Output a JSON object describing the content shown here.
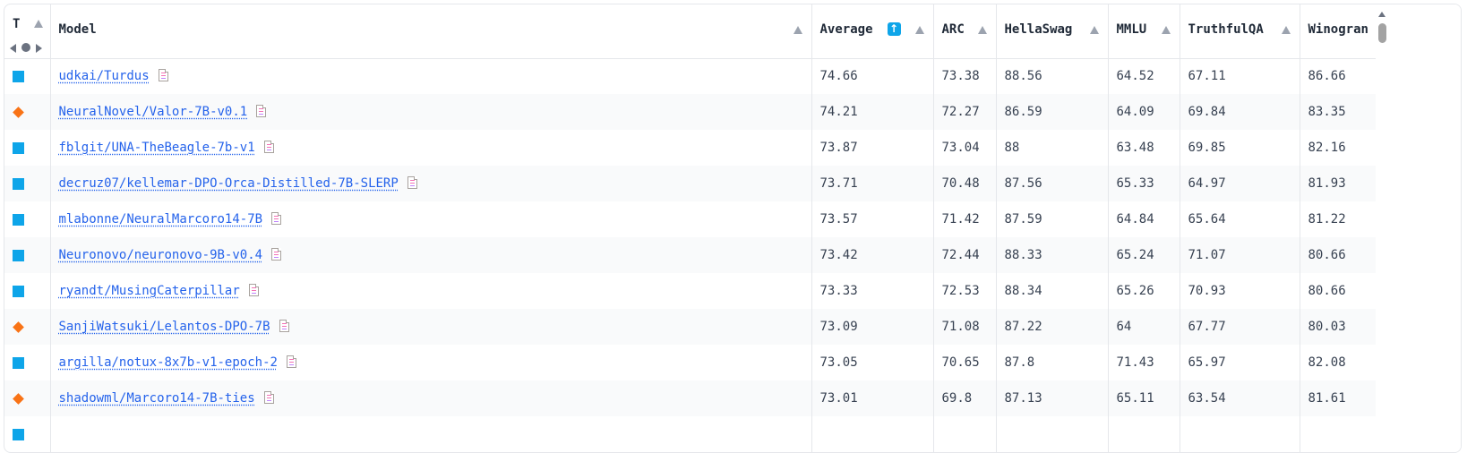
{
  "header": {
    "type_label": "T",
    "model": "Model",
    "average": "Average",
    "average_sort_icon": "arrow-up-icon",
    "arc": "ARC",
    "hellaswag": "HellaSwag",
    "mmlu": "MMLU",
    "truthfulqa": "TruthfulQA",
    "winogrande": "Winogran"
  },
  "colors": {
    "pretrained": "#0ea5e9",
    "finetuned": "#f97316",
    "link": "#2563eb"
  },
  "rows": [
    {
      "type": "square",
      "model": "udkai/Turdus",
      "average": "74.66",
      "arc": "73.38",
      "hellaswag": "88.56",
      "mmlu": "64.52",
      "truthfulqa": "67.11",
      "winogrande": "86.66"
    },
    {
      "type": "diamond",
      "model": "NeuralNovel/Valor-7B-v0.1",
      "average": "74.21",
      "arc": "72.27",
      "hellaswag": "86.59",
      "mmlu": "64.09",
      "truthfulqa": "69.84",
      "winogrande": "83.35"
    },
    {
      "type": "square",
      "model": "fblgit/UNA-TheBeagle-7b-v1",
      "average": "73.87",
      "arc": "73.04",
      "hellaswag": "88",
      "mmlu": "63.48",
      "truthfulqa": "69.85",
      "winogrande": "82.16"
    },
    {
      "type": "square",
      "model": "decruz07/kellemar-DPO-Orca-Distilled-7B-SLERP",
      "average": "73.71",
      "arc": "70.48",
      "hellaswag": "87.56",
      "mmlu": "65.33",
      "truthfulqa": "64.97",
      "winogrande": "81.93"
    },
    {
      "type": "square",
      "model": "mlabonne/NeuralMarcoro14-7B",
      "average": "73.57",
      "arc": "71.42",
      "hellaswag": "87.59",
      "mmlu": "64.84",
      "truthfulqa": "65.64",
      "winogrande": "81.22"
    },
    {
      "type": "square",
      "model": "Neuronovo/neuronovo-9B-v0.4",
      "average": "73.42",
      "arc": "72.44",
      "hellaswag": "88.33",
      "mmlu": "65.24",
      "truthfulqa": "71.07",
      "winogrande": "80.66"
    },
    {
      "type": "square",
      "model": "ryandt/MusingCaterpillar",
      "average": "73.33",
      "arc": "72.53",
      "hellaswag": "88.34",
      "mmlu": "65.26",
      "truthfulqa": "70.93",
      "winogrande": "80.66"
    },
    {
      "type": "diamond",
      "model": "SanjiWatsuki/Lelantos-DPO-7B",
      "average": "73.09",
      "arc": "71.08",
      "hellaswag": "87.22",
      "mmlu": "64",
      "truthfulqa": "67.77",
      "winogrande": "80.03"
    },
    {
      "type": "square",
      "model": "argilla/notux-8x7b-v1-epoch-2",
      "average": "73.05",
      "arc": "70.65",
      "hellaswag": "87.8",
      "mmlu": "71.43",
      "truthfulqa": "65.97",
      "winogrande": "82.08"
    },
    {
      "type": "diamond",
      "model": "shadowml/Marcoro14-7B-ties",
      "average": "73.01",
      "arc": "69.8",
      "hellaswag": "87.13",
      "mmlu": "65.11",
      "truthfulqa": "63.54",
      "winogrande": "81.61"
    }
  ]
}
